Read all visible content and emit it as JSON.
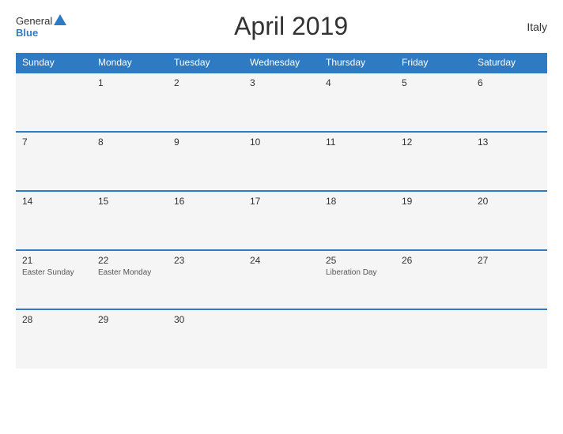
{
  "header": {
    "logo": {
      "general": "General",
      "blue": "Blue"
    },
    "title": "April 2019",
    "country": "Italy"
  },
  "days_of_week": [
    "Sunday",
    "Monday",
    "Tuesday",
    "Wednesday",
    "Thursday",
    "Friday",
    "Saturday"
  ],
  "weeks": [
    [
      {
        "date": "",
        "holiday": ""
      },
      {
        "date": "1",
        "holiday": ""
      },
      {
        "date": "2",
        "holiday": ""
      },
      {
        "date": "3",
        "holiday": ""
      },
      {
        "date": "4",
        "holiday": ""
      },
      {
        "date": "5",
        "holiday": ""
      },
      {
        "date": "6",
        "holiday": ""
      }
    ],
    [
      {
        "date": "7",
        "holiday": ""
      },
      {
        "date": "8",
        "holiday": ""
      },
      {
        "date": "9",
        "holiday": ""
      },
      {
        "date": "10",
        "holiday": ""
      },
      {
        "date": "11",
        "holiday": ""
      },
      {
        "date": "12",
        "holiday": ""
      },
      {
        "date": "13",
        "holiday": ""
      }
    ],
    [
      {
        "date": "14",
        "holiday": ""
      },
      {
        "date": "15",
        "holiday": ""
      },
      {
        "date": "16",
        "holiday": ""
      },
      {
        "date": "17",
        "holiday": ""
      },
      {
        "date": "18",
        "holiday": ""
      },
      {
        "date": "19",
        "holiday": ""
      },
      {
        "date": "20",
        "holiday": ""
      }
    ],
    [
      {
        "date": "21",
        "holiday": "Easter Sunday"
      },
      {
        "date": "22",
        "holiday": "Easter Monday"
      },
      {
        "date": "23",
        "holiday": ""
      },
      {
        "date": "24",
        "holiday": ""
      },
      {
        "date": "25",
        "holiday": "Liberation Day"
      },
      {
        "date": "26",
        "holiday": ""
      },
      {
        "date": "27",
        "holiday": ""
      }
    ],
    [
      {
        "date": "28",
        "holiday": ""
      },
      {
        "date": "29",
        "holiday": ""
      },
      {
        "date": "30",
        "holiday": ""
      },
      {
        "date": "",
        "holiday": ""
      },
      {
        "date": "",
        "holiday": ""
      },
      {
        "date": "",
        "holiday": ""
      },
      {
        "date": "",
        "holiday": ""
      }
    ]
  ]
}
